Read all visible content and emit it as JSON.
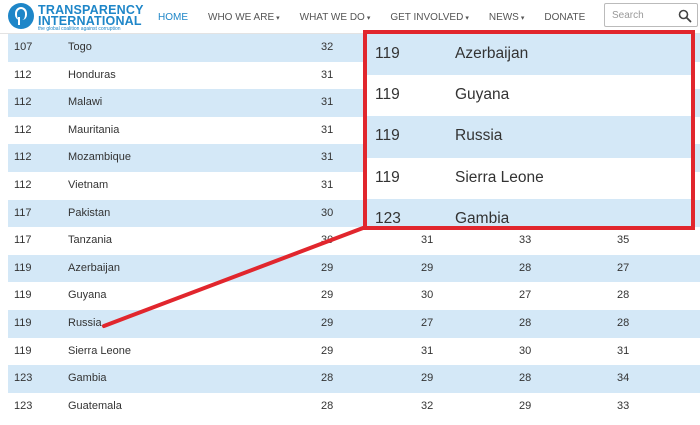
{
  "header": {
    "logo_line1": "TRANSPARENCY",
    "logo_line2": "INTERNATIONAL",
    "logo_tagline": "the global coalition against corruption",
    "nav": [
      {
        "label": "HOME",
        "active": true,
        "dropdown": false
      },
      {
        "label": "WHO WE ARE",
        "active": false,
        "dropdown": true
      },
      {
        "label": "WHAT WE DO",
        "active": false,
        "dropdown": true
      },
      {
        "label": "GET INVOLVED",
        "active": false,
        "dropdown": true
      },
      {
        "label": "NEWS",
        "active": false,
        "dropdown": true
      },
      {
        "label": "DONATE",
        "active": false,
        "dropdown": false
      }
    ],
    "search_placeholder": "Search"
  },
  "table": {
    "rows": [
      {
        "rank": "107",
        "country": "Togo",
        "s1": "32",
        "s2": "",
        "s3": "",
        "s4": ""
      },
      {
        "rank": "112",
        "country": "Honduras",
        "s1": "31",
        "s2": "",
        "s3": "",
        "s4": ""
      },
      {
        "rank": "112",
        "country": "Malawi",
        "s1": "31",
        "s2": "",
        "s3": "",
        "s4": ""
      },
      {
        "rank": "112",
        "country": "Mauritania",
        "s1": "31",
        "s2": "",
        "s3": "",
        "s4": ""
      },
      {
        "rank": "112",
        "country": "Mozambique",
        "s1": "31",
        "s2": "",
        "s3": "",
        "s4": ""
      },
      {
        "rank": "112",
        "country": "Vietnam",
        "s1": "31",
        "s2": "",
        "s3": "",
        "s4": ""
      },
      {
        "rank": "117",
        "country": "Pakistan",
        "s1": "30",
        "s2": "",
        "s3": "",
        "s4": ""
      },
      {
        "rank": "117",
        "country": "Tanzania",
        "s1": "30",
        "s2": "31",
        "s3": "33",
        "s4": "35"
      },
      {
        "rank": "119",
        "country": "Azerbaijan",
        "s1": "29",
        "s2": "29",
        "s3": "28",
        "s4": "27"
      },
      {
        "rank": "119",
        "country": "Guyana",
        "s1": "29",
        "s2": "30",
        "s3": "27",
        "s4": "28"
      },
      {
        "rank": "119",
        "country": "Russia",
        "s1": "29",
        "s2": "27",
        "s3": "28",
        "s4": "28"
      },
      {
        "rank": "119",
        "country": "Sierra Leone",
        "s1": "29",
        "s2": "31",
        "s3": "30",
        "s4": "31"
      },
      {
        "rank": "123",
        "country": "Gambia",
        "s1": "28",
        "s2": "29",
        "s3": "28",
        "s4": "34"
      },
      {
        "rank": "123",
        "country": "Guatemala",
        "s1": "28",
        "s2": "32",
        "s3": "29",
        "s4": "33"
      }
    ]
  },
  "callout": {
    "rows": [
      {
        "rank": "119",
        "country": "Azerbaijan"
      },
      {
        "rank": "119",
        "country": "Guyana"
      },
      {
        "rank": "119",
        "country": "Russia"
      },
      {
        "rank": "119",
        "country": "Sierra Leone"
      },
      {
        "rank": "123",
        "country": "Gambia"
      }
    ]
  },
  "colors": {
    "brand": "#1e86c8",
    "row_shade": "#d4e8f7",
    "highlight": "#e1262d"
  }
}
